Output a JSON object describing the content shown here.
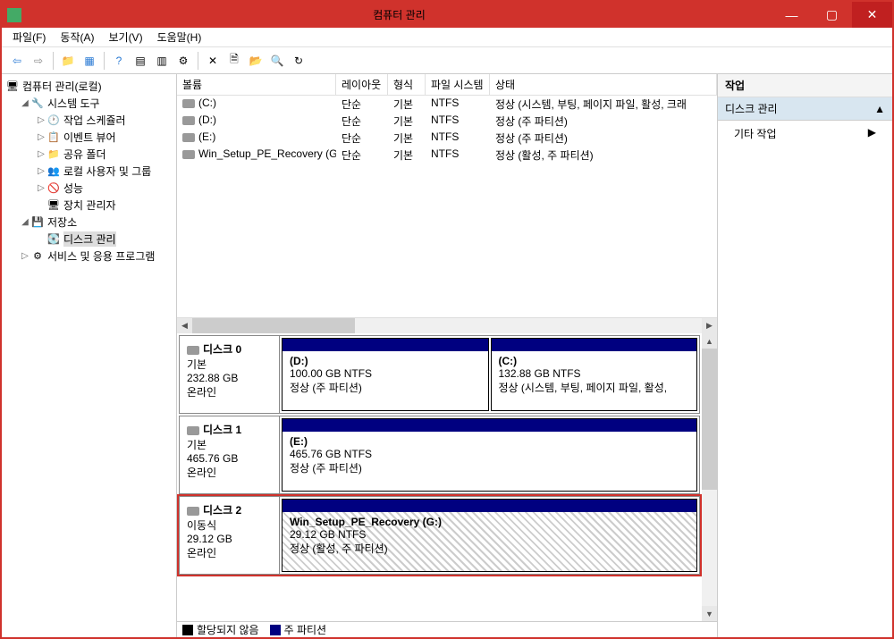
{
  "window": {
    "title": "컴퓨터 관리"
  },
  "menu": {
    "file": "파일(F)",
    "action": "동작(A)",
    "view": "보기(V)",
    "help": "도움말(H)"
  },
  "tree": {
    "root": "컴퓨터 관리(로컬)",
    "systools": "시스템 도구",
    "sched": "작업 스케쥴러",
    "event": "이벤트 뷰어",
    "share": "공유 폴더",
    "users": "로컬 사용자 및 그룹",
    "perf": "성능",
    "devmgr": "장치 관리자",
    "storage": "저장소",
    "diskmgmt": "디스크 관리",
    "services": "서비스 및 응용 프로그램"
  },
  "list": {
    "headers": {
      "volume": "볼륨",
      "layout": "레이아웃",
      "type": "형식",
      "fs": "파일 시스템",
      "status": "상태"
    },
    "rows": [
      {
        "vol": "(C:)",
        "layout": "단순",
        "type": "기본",
        "fs": "NTFS",
        "status": "정상 (시스템, 부팅, 페이지 파일, 활성, 크래"
      },
      {
        "vol": "(D:)",
        "layout": "단순",
        "type": "기본",
        "fs": "NTFS",
        "status": "정상 (주 파티션)"
      },
      {
        "vol": "(E:)",
        "layout": "단순",
        "type": "기본",
        "fs": "NTFS",
        "status": "정상 (주 파티션)"
      },
      {
        "vol": "Win_Setup_PE_Recovery (G:)",
        "layout": "단순",
        "type": "기본",
        "fs": "NTFS",
        "status": "정상 (활성, 주 파티션)"
      }
    ]
  },
  "disks": [
    {
      "name": "디스크 0",
      "type": "기본",
      "size": "232.88 GB",
      "state": "온라인",
      "parts": [
        {
          "label": "(D:)",
          "info": "100.00 GB NTFS",
          "status": "정상 (주 파티션)",
          "hatched": false
        },
        {
          "label": "(C:)",
          "info": "132.88 GB NTFS",
          "status": "정상 (시스템, 부팅, 페이지 파일, 활성,",
          "hatched": false
        }
      ],
      "highlight": false
    },
    {
      "name": "디스크 1",
      "type": "기본",
      "size": "465.76 GB",
      "state": "온라인",
      "parts": [
        {
          "label": "(E:)",
          "info": "465.76 GB NTFS",
          "status": "정상 (주 파티션)",
          "hatched": false
        }
      ],
      "highlight": false
    },
    {
      "name": "디스크 2",
      "type": "이동식",
      "size": "29.12 GB",
      "state": "온라인",
      "parts": [
        {
          "label": "Win_Setup_PE_Recovery  (G:)",
          "info": "29.12 GB NTFS",
          "status": "정상 (활성, 주 파티션)",
          "hatched": true
        }
      ],
      "highlight": true
    }
  ],
  "legend": {
    "unallocated": "할당되지 않음",
    "primary": "주 파티션"
  },
  "actions": {
    "header": "작업",
    "diskmgmt": "디스크 관리",
    "more": "기타 작업"
  }
}
